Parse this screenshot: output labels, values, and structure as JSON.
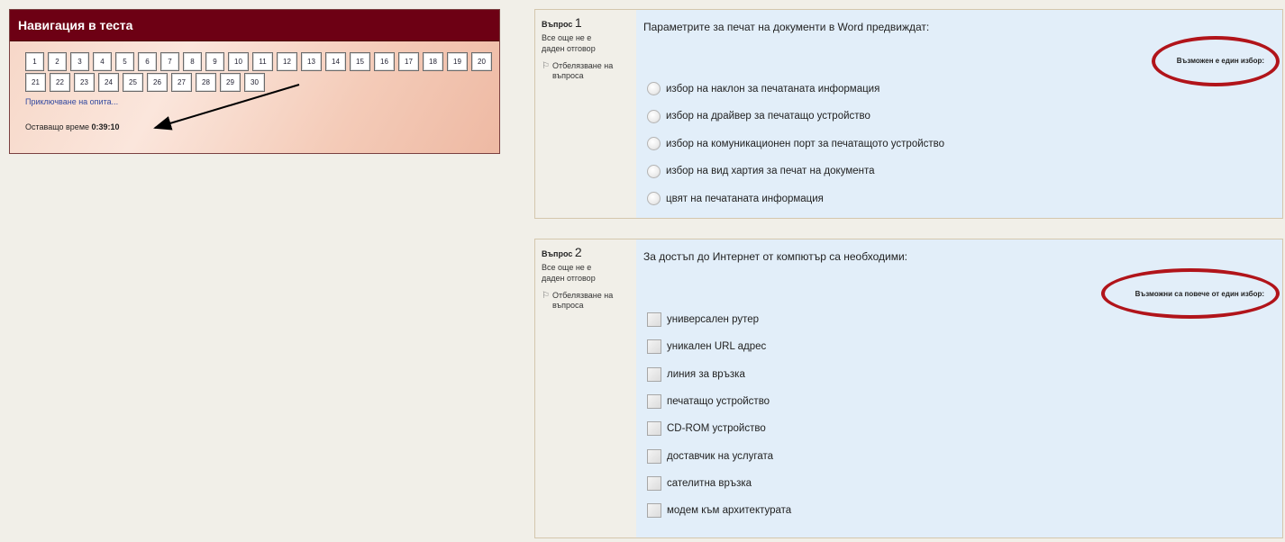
{
  "nav": {
    "title": "Навигация в теста",
    "question_numbers": [
      "1",
      "2",
      "3",
      "4",
      "5",
      "6",
      "7",
      "8",
      "9",
      "10",
      "11",
      "12",
      "13",
      "14",
      "15",
      "16",
      "17",
      "18",
      "19",
      "20",
      "21",
      "22",
      "23",
      "24",
      "25",
      "26",
      "27",
      "28",
      "29",
      "30"
    ],
    "finish_link": "Приключване на опита...",
    "time_label": "Оставащо време",
    "time_value": "0:39:10"
  },
  "questions": [
    {
      "label": "Въпрос",
      "number": "1",
      "state": "Все още не е даден отговор",
      "flag_label": "Отбелязване на въпроса",
      "text": "Параметрите за печат на документи в Word предвиждат:",
      "prompt": "Възможен е един избор:",
      "input_type": "radio",
      "answers": [
        "избор на наклон за печатаната информация",
        "избор на драйвер за печатащо устройство",
        "избор на комуникационен порт за печатащото устройство",
        "избор на вид хартия за печат на документа",
        "цвят на печатаната информация"
      ]
    },
    {
      "label": "Въпрос",
      "number": "2",
      "state": "Все още не е даден отговор",
      "flag_label": "Отбелязване на въпроса",
      "text": "За достъп до Интернет от компютър са необходими:",
      "prompt": "Възможни са повече от един избор:",
      "input_type": "checkbox",
      "answers": [
        "универсален рутер",
        "уникален URL адрес",
        "линия за връзка",
        "печатащо устройство",
        "CD-ROM устройство",
        "доставчик на услугата",
        "сателитна връзка",
        "модем към архитектурата"
      ]
    }
  ],
  "colors": {
    "nav_header": "#6d0014",
    "annotation_red": "#b1141a",
    "answer_bg": "#e2eef9",
    "page_bg": "#f1efe8"
  }
}
